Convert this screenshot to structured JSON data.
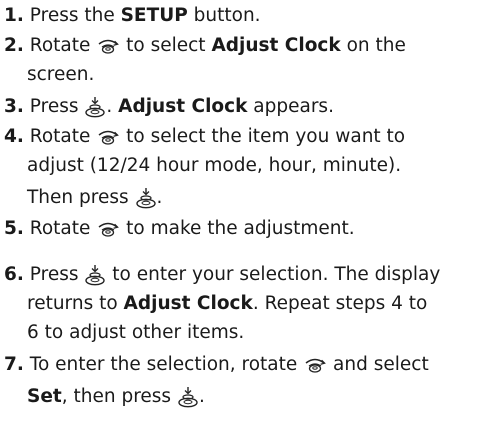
{
  "steps": [
    {
      "number": "1.",
      "t1": "Press the ",
      "b1": "SETUP",
      "t2": " button."
    },
    {
      "number": "2.",
      "t1": "Rotate ",
      "t2": " to select ",
      "b1": "Adjust Clock",
      "t3": " on the",
      "t4": "screen."
    },
    {
      "number": "3.",
      "t1": "Press ",
      "t2": ". ",
      "b1": "Adjust Clock",
      "t3": " appears."
    },
    {
      "number": "4.",
      "t1": "Rotate ",
      "t2": " to select the item you want to",
      "t3": "adjust (12/24 hour mode, hour, minute).",
      "t4": "Then press ",
      "t5": "."
    },
    {
      "number": "5.",
      "t1": "Rotate ",
      "t2": " to make the adjustment."
    },
    {
      "number": "6.",
      "t1": "Press ",
      "t2": " to enter your selection. The display",
      "t3": "returns to ",
      "b1": "Adjust Clock",
      "t4": ". Repeat steps 4 to",
      "t5": "6 to adjust other items."
    },
    {
      "number": "7.",
      "t1": "To enter the selection, rotate ",
      "t2": " and select",
      "b1": "Set",
      "t3": ", then press ",
      "t4": "."
    }
  ],
  "icons": {
    "rotate": "rotate-knob-icon",
    "press": "press-knob-icon"
  }
}
